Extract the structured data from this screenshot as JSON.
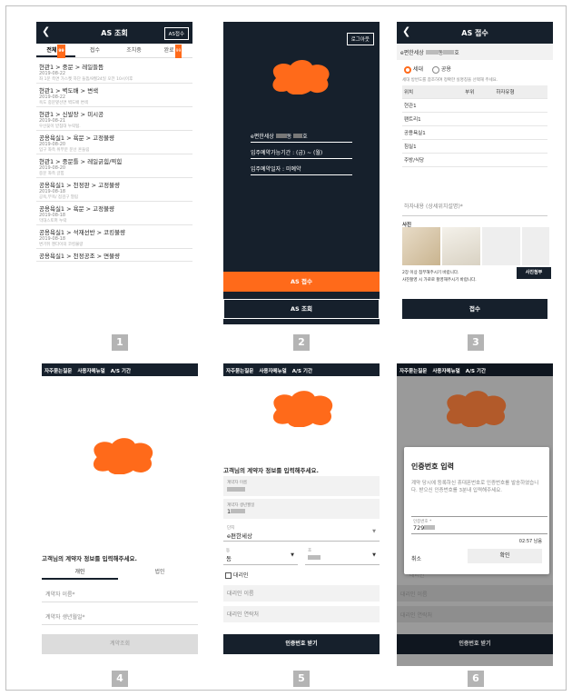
{
  "screen1": {
    "title": "AS 조회",
    "button": "AS접수",
    "tabs": [
      "전체",
      "접수",
      "조치중",
      "완료"
    ],
    "tab_badge_all": "99",
    "tab_badge_done": "99",
    "items": [
      {
        "title": "현관1 > 중문 > 레일들뜸",
        "date": "2019-08-22",
        "desc": "좌 1문 측면 가스켓 하단 들뜸/9월24일 오전 10시이후"
      },
      {
        "title": "현관1 > 벽도배 > 변색",
        "date": "2019-08-22",
        "desc": "욕도 중문옆선면 벽도배 변색"
      },
      {
        "title": "현관1 > 신발장 > 미시공",
        "date": "2019-08-21",
        "desc": "우산꽂이 받침대 누락됨."
      },
      {
        "title": "공용욕실1 > 욕문 > 고정불량",
        "date": "2019-08-20",
        "desc": "입구 좌측 위부분 문선 흔들림"
      },
      {
        "title": "현관1 > 중문틀 > 레일긁힘/찍힘",
        "date": "2019-08-20",
        "desc": "중문 좌측 긁힘"
      },
      {
        "title": "공용욕실1 > 천정판 > 고정불량",
        "date": "2019-08-18",
        "desc": "공욕,부욕/ 점검구 열림"
      },
      {
        "title": "공용욕실1 > 욕문 > 고정불량",
        "date": "2019-08-18",
        "desc": "막대스토퍼 누락"
      },
      {
        "title": "공용욕실1 > 석재선반 > 코킹불량",
        "date": "2019-08-18",
        "desc": "변기뒤 젠다이의 코킹불량"
      },
      {
        "title": "공용욕실1 > 천정공조 > 면불량",
        "date": "",
        "desc": ""
      }
    ]
  },
  "screen2": {
    "logout": "로그아웃",
    "complex": "e편한세상 ",
    "dong_suffix": "동",
    "ho_suffix": "호",
    "period_label": "입주예약가능기간 : ",
    "period_value": "(금) ~ (월)",
    "date_label": "입주예약일자 : 미예약",
    "btn_receive": "AS 접수",
    "btn_query": "AS 조회"
  },
  "screen3": {
    "title": "AS 접수",
    "address": "e편한세상 ",
    "addr_dong": "동",
    "addr_ho": "호",
    "radio1": "세대",
    "radio2": "공용",
    "hint": "세대 방번도를 참조하여 정확한 실명칭을 선택해 주세요.",
    "col_location": "위치",
    "col_part": "부위",
    "col_defect": "하자유형",
    "rows": [
      "현관1",
      "팬트리1",
      "공용욕실1",
      "침실1",
      "주방/식당"
    ],
    "detail_placeholder": "하자내용 (상세위치설명)*",
    "photo_label": "사진",
    "photo_note1": "2장 이상 첨부해주시기 바랍니다.",
    "photo_note2": "사진촬영 시 가로로 촬영해주시기 바랍니다.",
    "photo_btn": "사진첨부",
    "submit": "접수"
  },
  "screen4": {
    "menu": [
      "자주묻는질문",
      "사용자메뉴얼",
      "A/S 기간"
    ],
    "prompt": "고객님의 계약자 정보를 입력해주세요.",
    "tab_personal": "개인",
    "tab_corp": "법인",
    "name_placeholder": "계약자 이름*",
    "birth_placeholder": "계약자 생년월일*",
    "submit": "계약조회"
  },
  "screen5": {
    "menu": [
      "자주묻는질문",
      "사용자메뉴얼",
      "A/S 기간"
    ],
    "prompt": "고객님의 계약자 정보를 입력해주세요.",
    "name_label": "계약자 이름",
    "birth_label": "계약자 생년월일",
    "birth_value": "1",
    "complex_label": "단지",
    "complex_value": "e편한세상 ",
    "dong_label": "동",
    "dong_value": "동",
    "ho_label": "호",
    "agent_label": "대리인",
    "agent_name": "대리인 이름",
    "agent_phone": "대리인 연락처",
    "submit": "인증번호 받기"
  },
  "screen6": {
    "menu": [
      "자주묻는질문",
      "사용자메뉴얼",
      "A/S 기간"
    ],
    "modal_title": "인증번호 입력",
    "modal_text": "계약 당시에 등록하신 휴대폰번호로 인증번호를 발송하였습니다. 받으신 인증번호를 3분내 입력해주세요.",
    "code_label": "인증번호 *",
    "code_value": "729",
    "timer": "02:57 남음",
    "cancel": "취소",
    "confirm": "확인",
    "bg_agent_name": "대리인 이름",
    "bg_agent_phone": "대리인 연락처",
    "bg_agent": "대리인",
    "submit": "인증번호 받기"
  },
  "labels": [
    "1",
    "2",
    "3",
    "4",
    "5",
    "6"
  ],
  "colors": {
    "navy": "#16202c",
    "orange": "#ff6a1a",
    "gray": "#f2f2f2"
  }
}
